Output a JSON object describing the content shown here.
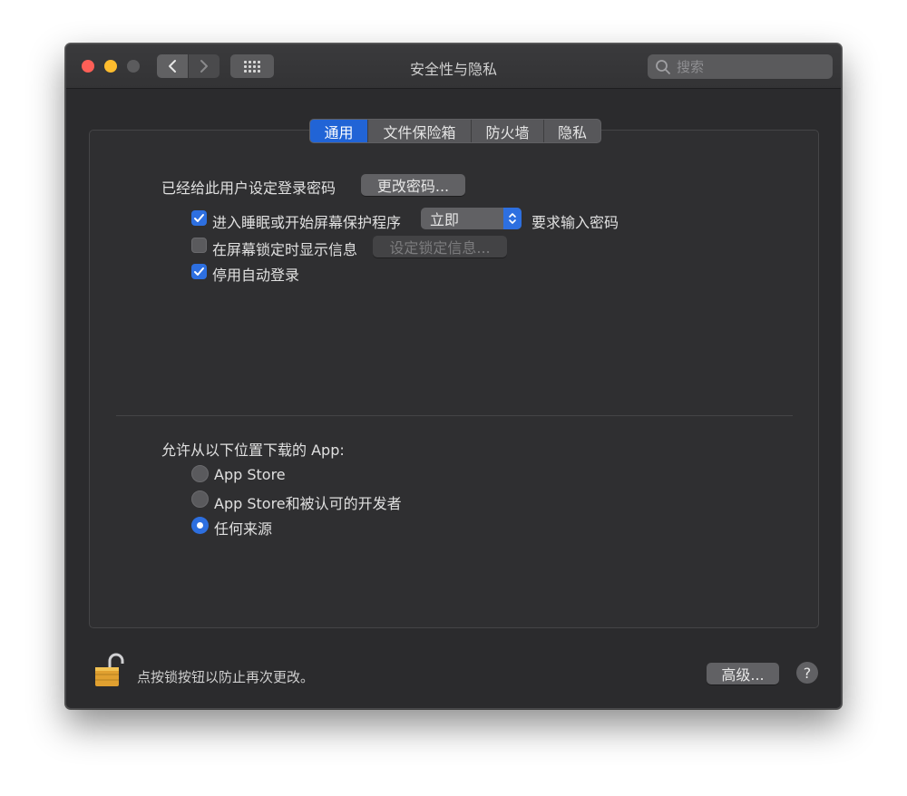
{
  "window": {
    "title": "安全性与隐私",
    "search_placeholder": "搜索"
  },
  "tabs": [
    {
      "label": "通用",
      "active": true
    },
    {
      "label": "文件保险箱",
      "active": false
    },
    {
      "label": "防火墙",
      "active": false
    },
    {
      "label": "隐私",
      "active": false
    }
  ],
  "general": {
    "password_set_label": "已经给此用户设定登录密码",
    "change_password_button": "更改密码...",
    "require_password": {
      "checked": true,
      "label": "进入睡眠或开始屏幕保护程序",
      "select_value": "立即",
      "suffix": "要求输入密码"
    },
    "show_message": {
      "checked": false,
      "label": "在屏幕锁定时显示信息",
      "button": "设定锁定信息..."
    },
    "disable_auto_login": {
      "checked": true,
      "label": "停用自动登录"
    }
  },
  "downloads": {
    "heading": "允许从以下位置下载的 App:",
    "options": [
      {
        "label": "App Store",
        "selected": false
      },
      {
        "label": "App Store和被认可的开发者",
        "selected": false
      },
      {
        "label": "任何来源",
        "selected": true
      }
    ]
  },
  "footer": {
    "lock_text": "点按锁按钮以防止再次更改。",
    "advanced_button": "高级...",
    "help_label": "?"
  },
  "colors": {
    "accent": "#2d6fe0",
    "close": "#fe5f57",
    "minimize": "#febc2e",
    "lock_gold": "#e0a030"
  }
}
